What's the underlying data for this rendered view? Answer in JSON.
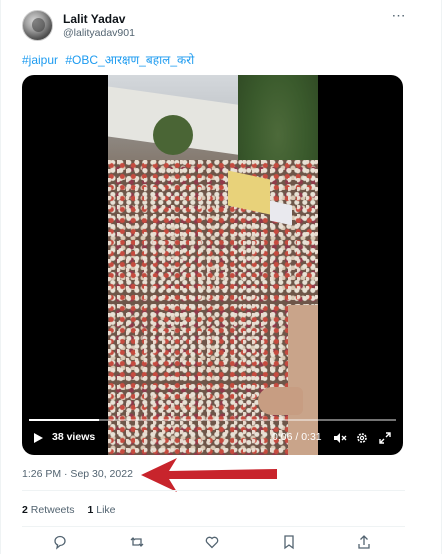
{
  "user": {
    "display_name": "Lalit Yadav",
    "handle": "@lalityadav901"
  },
  "more_icon": "⋯",
  "tweet": {
    "hashtags": [
      "#jaipur",
      "#OBC_आरक्षण_बहाल_करो"
    ]
  },
  "video": {
    "views_label": "38 views",
    "time_label": "0:06 / 0:31",
    "progress": 0.19
  },
  "timestamp": "1:26 PM · Sep 30, 2022",
  "stats": {
    "retweets_count": "2",
    "retweets_label": "Retweets",
    "likes_count": "1",
    "likes_label": "Like"
  },
  "colors": {
    "link": "#1d9bf0",
    "muted": "#536471",
    "annotation_arrow": "#c8242c"
  },
  "icons": [
    "more-icon",
    "play-icon",
    "volume-muted-icon",
    "gear-icon",
    "expand-icon",
    "reply-icon",
    "retweet-icon",
    "like-icon",
    "bookmark-icon",
    "share-icon"
  ]
}
